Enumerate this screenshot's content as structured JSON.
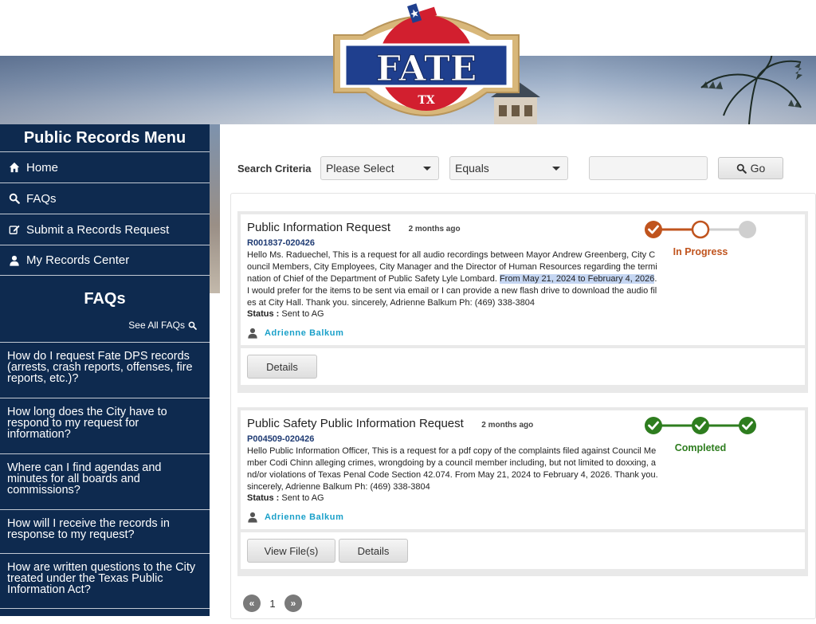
{
  "banner": {
    "logo_text": "FATE",
    "logo_subtext": "TX"
  },
  "sidebar": {
    "menu_title": "Public Records Menu",
    "menu_items": [
      {
        "label": "Home",
        "icon": "home-icon"
      },
      {
        "label": "FAQs",
        "icon": "search-icon"
      },
      {
        "label": "Submit a Records Request",
        "icon": "edit-icon"
      },
      {
        "label": "My Records Center",
        "icon": "user-icon"
      }
    ],
    "faq_title": "FAQs",
    "see_all_label": "See All FAQs",
    "faqs": [
      "How do I request Fate DPS records (arrests, crash reports, offenses, fire reports, etc.)?",
      "How long does the City have to respond to my request for information?",
      "Where can I find agendas and minutes for all boards and commissions?",
      "How will I receive the records in response to my request?",
      "How are written questions to the City treated under the Texas Public Information Act?"
    ]
  },
  "search": {
    "label": "Search Criteria",
    "field_select": "Please Select",
    "operator_select": "Equals",
    "value": "",
    "go_label": "Go"
  },
  "requests": [
    {
      "title": "Public Information Request",
      "ago": "2 months ago",
      "number": "R001837-020426",
      "desc_before": "Hello Ms. Raduechel, This is a request for all audio recordings between Mayor Andrew Greenberg, City Council Members, City Employees, City Manager and the Director of Human Resources regarding the termination of Chief of the Department of Public Safety Lyle Lombard. ",
      "desc_highlight": "From May 21, 2024 to February 4, 2026",
      "desc_after": ". I would prefer for the items to be sent via email or I can provide a new flash drive to download the audio files at City Hall. Thank you. sincerely, Adrienne Balkum Ph: (469) 338-3804",
      "status_label": "Status :",
      "status_value": "Sent to AG",
      "requester": "Adrienne Balkum",
      "progress_label": "In Progress",
      "progress_color": "#c0541e",
      "buttons": [
        "Details"
      ]
    },
    {
      "title": "Public Safety Public Information Request",
      "ago": "2 months ago",
      "number": "P004509-020426",
      "desc_before": "Hello Public Information Officer, This is a request for a pdf copy of the complaints filed against Council Member Codi Chinn alleging crimes, wrongdoing by a council member including, but not limited to doxxing, and/or violations of Texas Penal Code Section 42.074. From May 21, 2024 to February 4, 2026. Thank you. sincerely, Adrienne Balkum Ph: (469) 338-3804",
      "desc_highlight": "",
      "desc_after": "",
      "status_label": "Status :",
      "status_value": "Sent to AG",
      "requester": "Adrienne Balkum",
      "progress_label": "Completed",
      "progress_color": "#2e7d1f",
      "buttons": [
        "View File(s)",
        "Details"
      ]
    }
  ],
  "pager": {
    "prev": "«",
    "current": "1",
    "next": "»"
  }
}
